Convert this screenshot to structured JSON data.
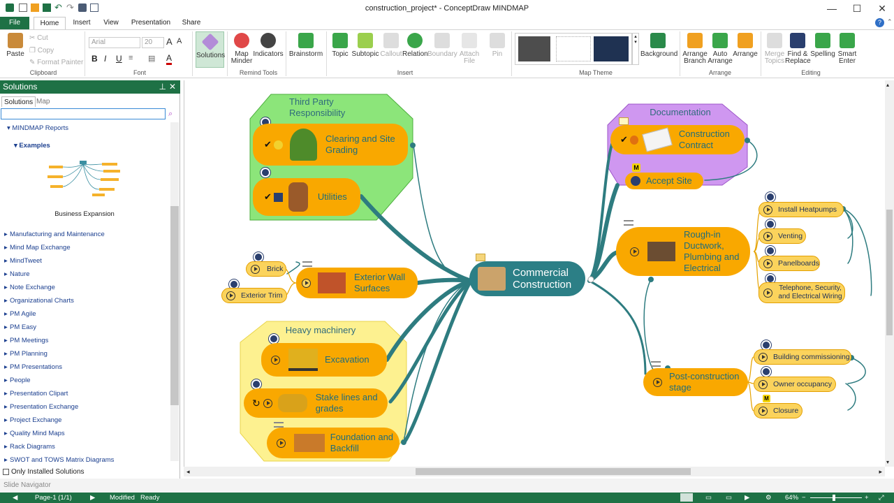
{
  "window": {
    "title": "construction_project* - ConceptDraw MINDMAP"
  },
  "tabs": [
    "File",
    "Home",
    "Insert",
    "View",
    "Presentation",
    "Share"
  ],
  "ribbon": {
    "clipboard": {
      "paste": "Paste",
      "cut": "Cut",
      "copy": "Copy",
      "format_painter": "Format Painter",
      "group": "Clipboard"
    },
    "font": {
      "name": "Arial",
      "size": "20",
      "group": "Font"
    },
    "solutions": "Solutions",
    "remind": {
      "map_minder": "Map Minder",
      "indicators": "Indicators",
      "group": "Remind Tools"
    },
    "brainstorm": "Brainstorm",
    "insert": {
      "topic": "Topic",
      "subtopic": "Subtopic",
      "callout": "Callout",
      "relation": "Relation",
      "boundary": "Boundary",
      "attach_file": "Attach File",
      "pin": "Pin",
      "group": "Insert"
    },
    "theme": {
      "background": "Background",
      "group": "Map Theme"
    },
    "arrange": {
      "arrange_branch": "Arrange Branch",
      "auto_arrange": "Auto Arrange",
      "arrange": "Arrange",
      "group": "Arrange"
    },
    "editing": {
      "merge_topics": "Merge Topics",
      "find_replace": "Find & Replace",
      "spelling": "Spelling",
      "smart_enter": "Smart Enter",
      "group": "Editing"
    }
  },
  "panel": {
    "title": "Solutions",
    "tabs": [
      "Solutions",
      "Map Minder"
    ],
    "search_value": "",
    "section": "MINDMAP Reports",
    "subsection": "Examples",
    "example": "Business Expansion",
    "items": [
      "Manufacturing and Maintenance",
      "Mind Map Exchange",
      "MindTweet",
      "Nature",
      "Note Exchange",
      "Organizational Charts",
      "PM Agile",
      "PM Easy",
      "PM Meetings",
      "PM Planning",
      "PM Presentations",
      "People",
      "Presentation Clipart",
      "Presentation Exchange",
      "Project Exchange",
      "Quality Mind Maps",
      "Rack Diagrams",
      "SWOT and TOWS Matrix Diagrams"
    ],
    "only_installed": "Only Installed Solutions"
  },
  "slide_navigator": "Slide Navigator",
  "status": {
    "page": "Page-1 (1/1)",
    "modified": "Modified",
    "ready": "Ready",
    "zoom": "64%"
  },
  "map": {
    "central": "Commercial Construction",
    "boundaries": {
      "third_party": "Third Party Responsibility",
      "documentation": "Documentation",
      "heavy": "Heavy machinery"
    },
    "clearing": "Clearing and Site Grading",
    "utilities": "Utilities",
    "exterior_wall": "Exterior Wall Surfaces",
    "brick": "Brick",
    "exterior_trim": "Exterior Trim",
    "excavation": "Excavation",
    "stake_lines": "Stake lines and grades",
    "foundation": "Foundation and Backfill",
    "contract": "Construction Contract",
    "accept_site": "Accept Site",
    "roughin": "Rough-in Ductwork, Plumbing and Electrical",
    "heatpumps": "Install Heatpumps",
    "venting": "Venting",
    "panelboards": "Panelboards",
    "telephone": "Telephone, Security, and Electrical Wiring",
    "post": "Post-construction stage",
    "commissioning": "Building commissioning",
    "occupancy": "Owner occupancy",
    "closure": "Closure",
    "m_marker": "M"
  },
  "colors": {
    "brand": "#1e7145",
    "central": "#2c7f86",
    "topic": "#f9a800",
    "subtopic": "#fbd35c",
    "link": "#2e7c80"
  }
}
